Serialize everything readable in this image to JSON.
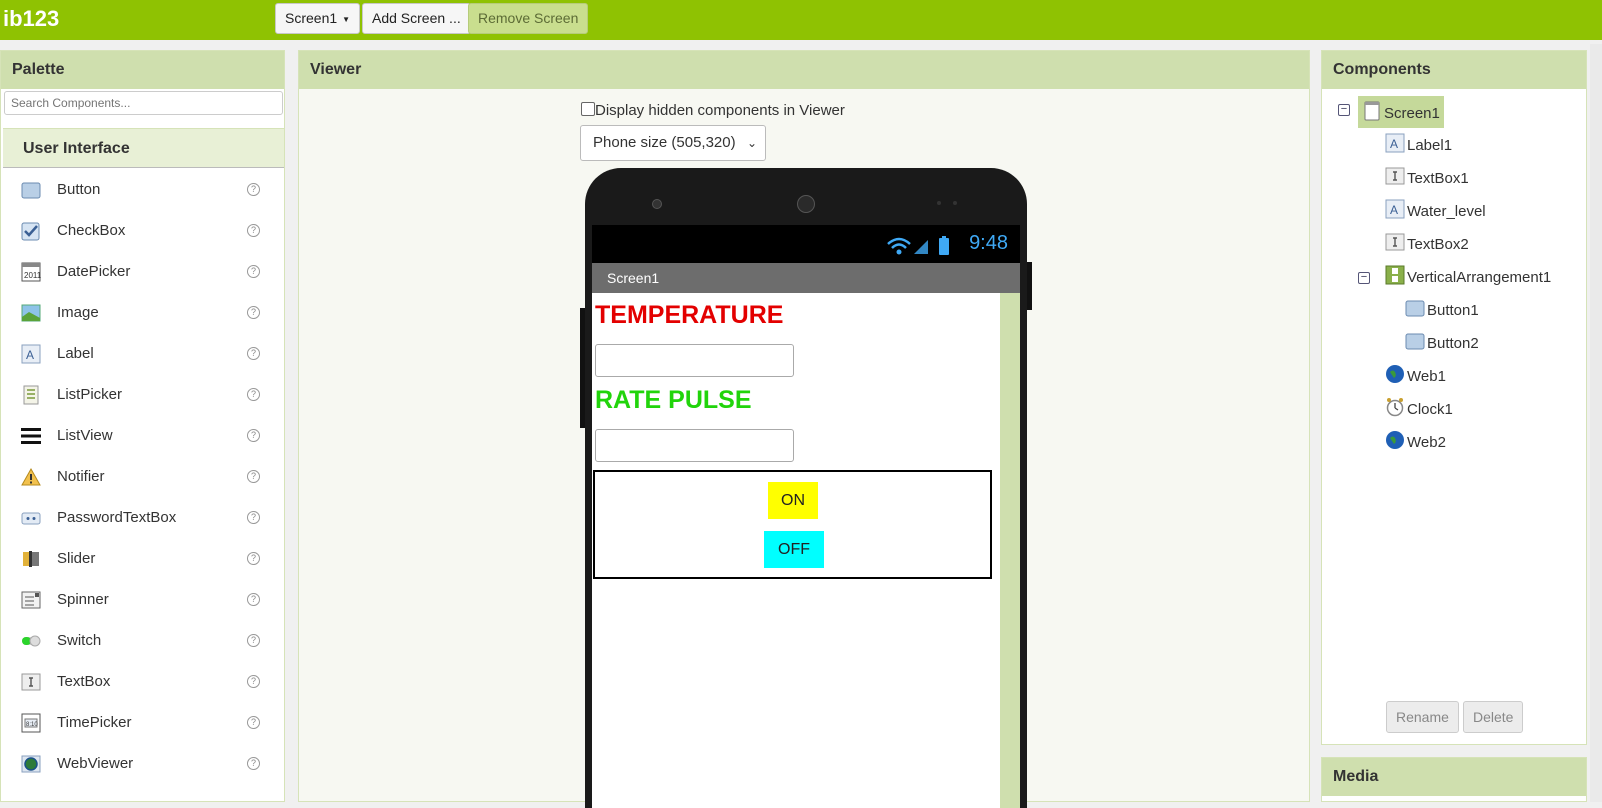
{
  "app": {
    "title": "ib123"
  },
  "toolbar": {
    "screen_select": "Screen1",
    "add_screen": "Add Screen ...",
    "remove_screen": "Remove Screen"
  },
  "palette": {
    "header": "Palette",
    "search_placeholder": "Search Components...",
    "category": "User Interface",
    "items": [
      {
        "label": "Button",
        "icon": "button-icon"
      },
      {
        "label": "CheckBox",
        "icon": "checkbox-icon"
      },
      {
        "label": "DatePicker",
        "icon": "datepicker-icon"
      },
      {
        "label": "Image",
        "icon": "image-icon"
      },
      {
        "label": "Label",
        "icon": "label-icon"
      },
      {
        "label": "ListPicker",
        "icon": "listpicker-icon"
      },
      {
        "label": "ListView",
        "icon": "listview-icon"
      },
      {
        "label": "Notifier",
        "icon": "notifier-icon"
      },
      {
        "label": "PasswordTextBox",
        "icon": "password-icon"
      },
      {
        "label": "Slider",
        "icon": "slider-icon"
      },
      {
        "label": "Spinner",
        "icon": "spinner-icon"
      },
      {
        "label": "Switch",
        "icon": "switch-icon"
      },
      {
        "label": "TextBox",
        "icon": "textbox-icon"
      },
      {
        "label": "TimePicker",
        "icon": "timepicker-icon"
      },
      {
        "label": "WebViewer",
        "icon": "webviewer-icon"
      }
    ],
    "help_glyph": "?"
  },
  "viewer": {
    "header": "Viewer",
    "hidden_checkbox_label": "Display hidden components in Viewer",
    "size_select": "Phone size (505,320)",
    "phone": {
      "clock": "9:48",
      "screen_title": "Screen1",
      "temperature_label": "TEMPERATURE",
      "pulse_label": "RATE PULSE",
      "on_button": "ON",
      "off_button": "OFF"
    }
  },
  "components": {
    "header": "Components",
    "tree": [
      {
        "label": "Screen1",
        "icon": "screen-icon"
      },
      {
        "label": "Label1",
        "icon": "label-icon"
      },
      {
        "label": "TextBox1",
        "icon": "textbox-icon"
      },
      {
        "label": "Water_level",
        "icon": "label-icon"
      },
      {
        "label": "TextBox2",
        "icon": "textbox-icon"
      },
      {
        "label": "VerticalArrangement1",
        "icon": "vertical-arrangement-icon"
      },
      {
        "label": "Button1",
        "icon": "button-icon"
      },
      {
        "label": "Button2",
        "icon": "button-icon"
      },
      {
        "label": "Web1",
        "icon": "globe-icon"
      },
      {
        "label": "Clock1",
        "icon": "clock-icon"
      },
      {
        "label": "Web2",
        "icon": "globe-icon"
      }
    ],
    "rename": "Rename",
    "delete": "Delete"
  },
  "media": {
    "header": "Media"
  },
  "colors": {
    "topbar": "#8fc202",
    "panel_header": "#cfdfae",
    "temperature": "#e30000",
    "pulse": "#21d40b",
    "on_button": "#ffff00",
    "off_button": "#00ffff"
  }
}
